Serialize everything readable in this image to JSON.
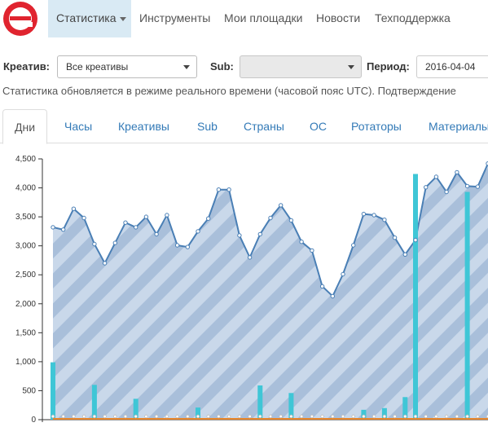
{
  "nav": {
    "items": [
      {
        "label": "Статистика",
        "active": true
      },
      {
        "label": "Инструменты"
      },
      {
        "label": "Мои площадки"
      },
      {
        "label": "Новости"
      },
      {
        "label": "Техподдержка"
      }
    ],
    "logo_icon": "e-logo-icon",
    "logo_color": "#e0242f",
    "active_bg": "#d9eaf4"
  },
  "filters": {
    "creative_label": "Креатив:",
    "creative_value": "Все креативы",
    "sub_label": "Sub:",
    "sub_value": "",
    "period_label": "Период:",
    "period_value": "2016-04-04"
  },
  "note": "Статистика обновляется в режиме реального времени (часовой пояс UTC). Подтверждение",
  "tabs": [
    {
      "label": "Дни",
      "active": true
    },
    {
      "label": "Часы"
    },
    {
      "label": "Креативы"
    },
    {
      "label": "Sub"
    },
    {
      "label": "Страны"
    },
    {
      "label": "ОС"
    },
    {
      "label": "Ротаторы"
    },
    {
      "label": "Материалы"
    }
  ],
  "chart_data": {
    "type": "area",
    "title": "",
    "xlabel": "",
    "ylabel": "",
    "ylim": [
      0,
      4500
    ],
    "yticks": [
      "0",
      "500",
      "1,000",
      "1,500",
      "2,000",
      "2,500",
      "3,000",
      "3,500",
      "4,000",
      "4,500"
    ],
    "grid": false,
    "series": [
      {
        "kind": "area",
        "color": "#4a7fb5",
        "fill": "#c9d8ea",
        "values": [
          3320,
          3280,
          3640,
          3480,
          3030,
          2700,
          3050,
          3400,
          3320,
          3500,
          3200,
          3530,
          3010,
          2980,
          3250,
          3470,
          3970,
          3970,
          3180,
          2800,
          3200,
          3480,
          3700,
          3440,
          3070,
          2920,
          2300,
          2130,
          2510,
          3010,
          3550,
          3530,
          3450,
          3140,
          2850,
          3100,
          4010,
          4190,
          3930,
          4270,
          4030,
          4020,
          4420
        ]
      },
      {
        "kind": "bar",
        "color": "#3fc6d6",
        "values": [
          990,
          0,
          0,
          0,
          600,
          0,
          0,
          0,
          360,
          0,
          0,
          0,
          0,
          0,
          210,
          0,
          0,
          0,
          0,
          0,
          590,
          0,
          0,
          460,
          0,
          0,
          0,
          0,
          0,
          0,
          170,
          0,
          200,
          0,
          390,
          4240,
          0,
          0,
          0,
          0,
          3930,
          0,
          0
        ]
      },
      {
        "kind": "line",
        "color": "#e8862a",
        "values": [
          0,
          0,
          0,
          0,
          0,
          0,
          0,
          0,
          0,
          0,
          0,
          0,
          0,
          0,
          0,
          0,
          0,
          0,
          0,
          0,
          0,
          0,
          0,
          0,
          0,
          0,
          0,
          0,
          0,
          0,
          0,
          0,
          0,
          0,
          0,
          0,
          0,
          0,
          0,
          0,
          0,
          0,
          0
        ]
      }
    ]
  }
}
